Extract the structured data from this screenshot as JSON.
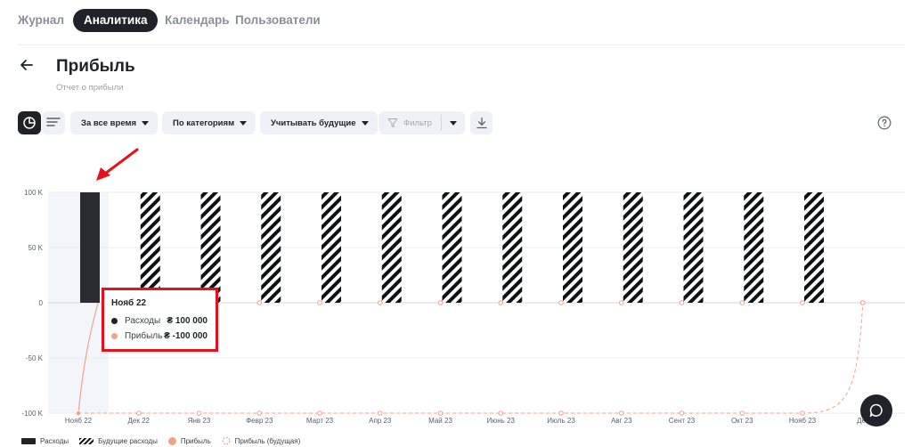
{
  "nav": {
    "items": [
      {
        "label": "Журнал",
        "active": false
      },
      {
        "label": "Аналитика",
        "active": true
      },
      {
        "label": "Календарь",
        "active": false
      },
      {
        "label": "Пользователи",
        "active": false
      }
    ]
  },
  "header": {
    "title": "Прибыль",
    "subtitle": "Отчет о прибыли"
  },
  "toolbar": {
    "period_label": "За все время",
    "group_label": "По категориям",
    "future_label": "Учитывать будущие",
    "filter_placeholder": "Фильтр"
  },
  "tooltip": {
    "title": "Нояб 22",
    "rows": [
      {
        "label": "Расходы",
        "value": "₴ 100 000",
        "color": "#1f2328"
      },
      {
        "label": "Прибыль",
        "value": "₴ -100 000",
        "color": "#f4a189"
      }
    ]
  },
  "legend": {
    "items": [
      {
        "label": "Расходы"
      },
      {
        "label": "Будущие расходы"
      },
      {
        "label": "Прибыль"
      },
      {
        "label": "Прибыль (будущая)"
      }
    ]
  },
  "colors": {
    "expense": "#2a2c31",
    "profit": "#f4a189",
    "highlight": "#e8101b",
    "selection_band": "#f3f5fa"
  },
  "chart_data": {
    "type": "bar",
    "categories": [
      "Нояб 22",
      "Дек 22",
      "Янв 23",
      "Февр 23",
      "Март 23",
      "Апр 23",
      "Май 23",
      "Июнь 23",
      "Июль 23",
      "Авг 23",
      "Сент 23",
      "Окт 23",
      "Нояб 23",
      "Дек"
    ],
    "series": [
      {
        "name": "Расходы",
        "kind": "bar",
        "values": [
          100000,
          null,
          null,
          null,
          null,
          null,
          null,
          null,
          null,
          null,
          null,
          null,
          null,
          null
        ]
      },
      {
        "name": "Будущие расходы",
        "kind": "bar-hatched",
        "values": [
          null,
          100000,
          100000,
          100000,
          100000,
          100000,
          100000,
          100000,
          100000,
          100000,
          100000,
          100000,
          100000,
          null
        ]
      },
      {
        "name": "Прибыль",
        "kind": "line",
        "values": [
          -100000,
          null,
          null,
          null,
          null,
          null,
          null,
          null,
          null,
          null,
          null,
          null,
          null,
          null
        ]
      },
      {
        "name": "Прибыль (будущая)",
        "kind": "line-dashed",
        "values": [
          -100000,
          -100000,
          -100000,
          -100000,
          -100000,
          -100000,
          -100000,
          -100000,
          -100000,
          -100000,
          -100000,
          -100000,
          -100000,
          0
        ]
      }
    ],
    "secondary_points": [
      null,
      0,
      0,
      0,
      0,
      0,
      0,
      0,
      0,
      0,
      0,
      0,
      0,
      0
    ],
    "yticks": [
      "100 K",
      "50 K",
      "0",
      "-50 K",
      "-100 K"
    ],
    "ytick_values": [
      100000,
      50000,
      0,
      -50000,
      -100000
    ],
    "ylim": [
      -100000,
      100000
    ],
    "grid": true,
    "legend_position": "bottom-left",
    "highlighted_category": "Нояб 22"
  }
}
